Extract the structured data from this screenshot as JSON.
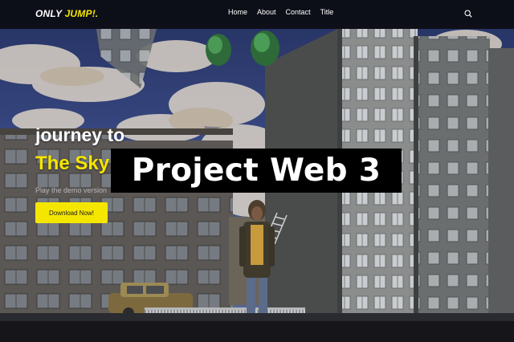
{
  "navbar": {
    "logo_main": "ONLY ",
    "logo_accent": "JUMP!.",
    "links": [
      "Home",
      "About",
      "Contact",
      "Title"
    ],
    "search_icon": "search-icon"
  },
  "hero": {
    "line1": "journey to",
    "line2": "The Sky",
    "subtitle": "Play the demo version",
    "button_label": "Download Now!"
  },
  "overlay": {
    "text": "Project Web 3"
  },
  "colors": {
    "accent": "#f5e600",
    "navbar_bg": "#0a0a0e",
    "banner_bg": "#000000"
  }
}
